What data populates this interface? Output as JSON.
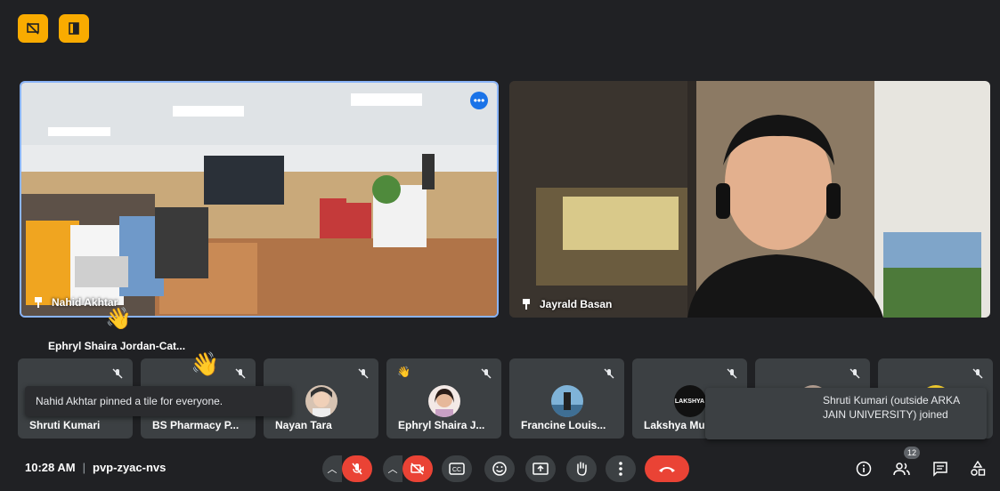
{
  "tiles": {
    "main": [
      {
        "name": "Nahid Akhtar"
      },
      {
        "name": "Jayrald Basan"
      }
    ],
    "raised_hand_name": "Ephryl Shaira Jordan-Cat...",
    "strip": [
      {
        "name": "Shruti Kumari"
      },
      {
        "name": "BS Pharmacy P..."
      },
      {
        "name": "Nayan Tara"
      },
      {
        "name": "Ephryl Shaira J..."
      },
      {
        "name": "Francine Louis..."
      },
      {
        "name": "Lakshya Mu"
      },
      {
        "name": ""
      },
      {
        "name": ""
      }
    ],
    "lakshya_logo_text": "LAKSHYA"
  },
  "toasts": {
    "pinned": "Nahid Akhtar pinned a tile for everyone.",
    "joined": "Shruti Kumari (outside ARKA JAIN UNIVERSITY) joined"
  },
  "footer": {
    "time": "10:28 AM",
    "separator": "|",
    "meeting_code": "pvp-zyac-nvs",
    "participant_count": "12"
  },
  "colors": {
    "accent": "#8ab4f8",
    "danger": "#ea4335",
    "top_button": "#f9ab00",
    "background": "#202124"
  }
}
